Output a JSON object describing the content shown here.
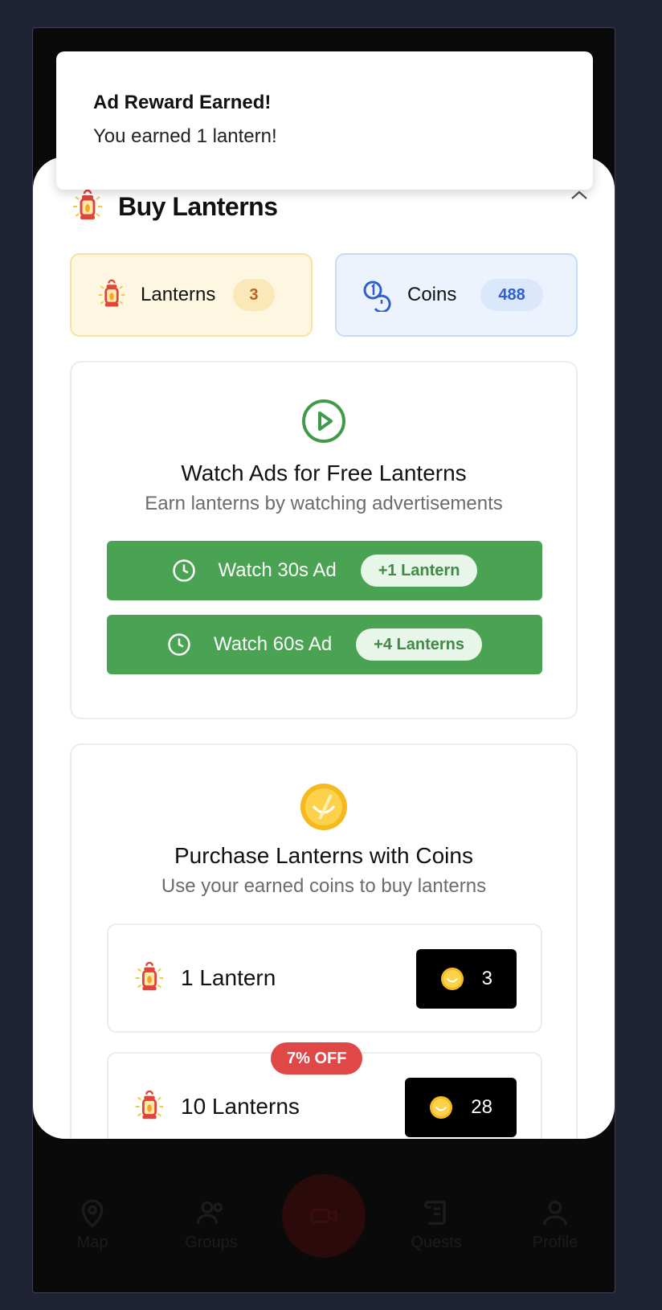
{
  "toast": {
    "title": "Ad Reward Earned!",
    "message": "You earned 1 lantern!"
  },
  "header": {
    "title": "Buy Lanterns"
  },
  "stats": {
    "lanterns": {
      "label": "Lanterns",
      "value": "3"
    },
    "coins": {
      "label": "Coins",
      "value": "488"
    }
  },
  "ads": {
    "title": "Watch Ads for Free Lanterns",
    "subtitle": "Earn lanterns by watching advertisements",
    "buttons": [
      {
        "label": "Watch 30s Ad",
        "reward": "+1 Lantern"
      },
      {
        "label": "Watch 60s Ad",
        "reward": "+4 Lanterns"
      }
    ]
  },
  "purchase": {
    "title": "Purchase Lanterns with Coins",
    "subtitle": "Use your earned coins to buy lanterns",
    "items": [
      {
        "label": "1 Lantern",
        "price": "3",
        "badge": ""
      },
      {
        "label": "10 Lanterns",
        "price": "28",
        "badge": "7% OFF"
      }
    ]
  },
  "nav": {
    "items": [
      "Map",
      "Groups",
      "",
      "Quests",
      "Profile"
    ]
  },
  "colors": {
    "accent_green": "#4aa352",
    "badge_red": "#e04848",
    "lantern_red": "#e0453a"
  }
}
